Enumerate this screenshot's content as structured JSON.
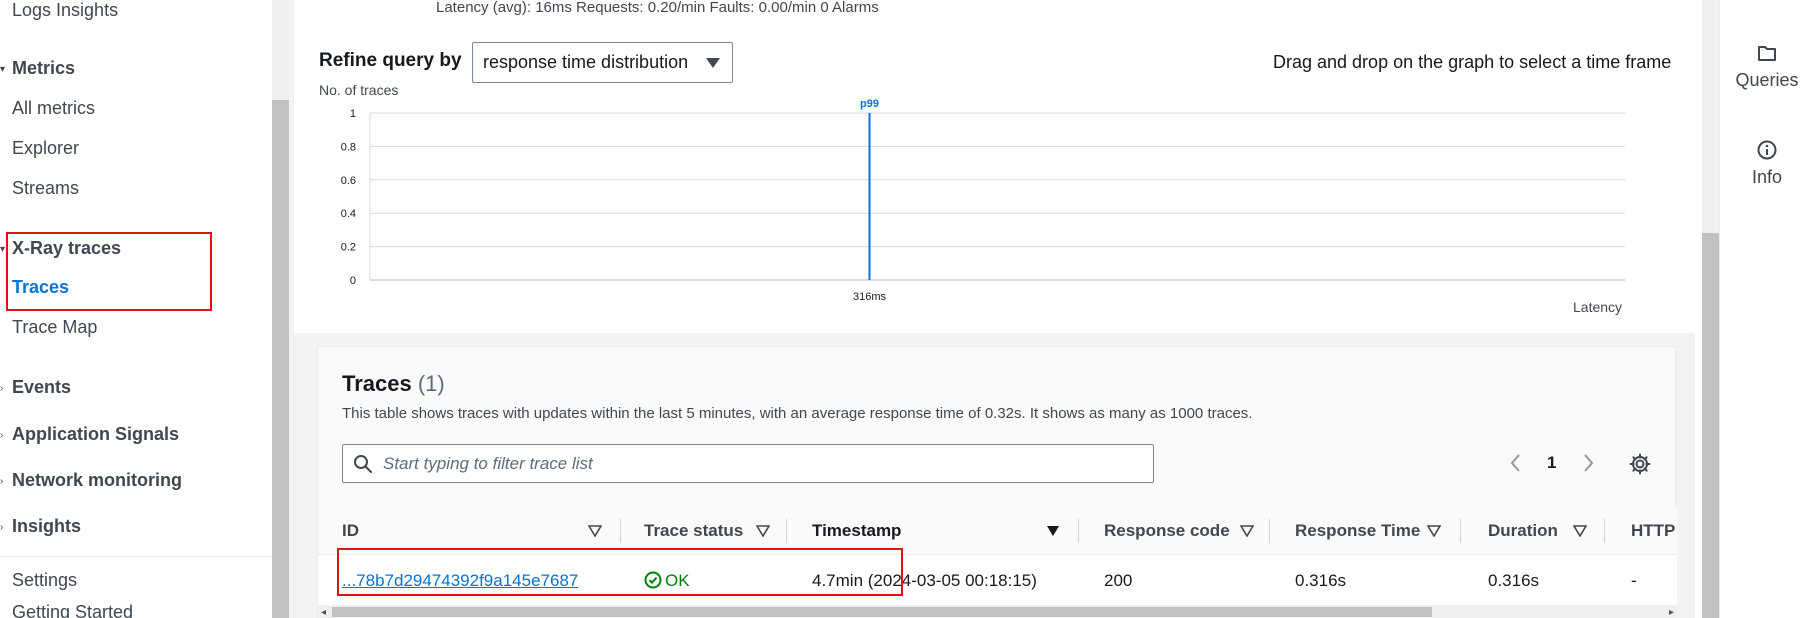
{
  "nav": {
    "logs_insights": "Logs Insights",
    "metrics": "Metrics",
    "all_metrics": "All metrics",
    "explorer": "Explorer",
    "streams": "Streams",
    "xray_traces": "X-Ray traces",
    "traces": "Traces",
    "trace_map": "Trace Map",
    "events": "Events",
    "application_signals": "Application Signals",
    "network_monitoring": "Network monitoring",
    "insights": "Insights",
    "settings": "Settings",
    "getting_started": "Getting Started"
  },
  "right_panel": {
    "queries": "Queries",
    "info": "Info"
  },
  "chart_panel": {
    "metrics_line": "Latency (avg): 16ms   Requests: 0.20/min   Faults: 0.00/min   0 Alarms",
    "refine_label": "Refine query by",
    "refine_value": "response time distribution",
    "drag_hint": "Drag and drop on the graph to select a time frame"
  },
  "chart_data": {
    "type": "bar",
    "ylabel": "No. of traces",
    "xlabel": "Latency",
    "y_ticks": [
      "0",
      "0.2",
      "0.4",
      "0.6",
      "0.8",
      "1"
    ],
    "ylim": [
      0,
      1
    ],
    "categories": [
      "316ms"
    ],
    "values": [
      1
    ],
    "annotation": "p99",
    "accent_color": "#0972d3",
    "grid": true
  },
  "traces": {
    "title": "Traces",
    "count": "(1)",
    "description": "This table shows traces with updates within the last 5 minutes, with an average response time of 0.32s. It shows as many as 1000 traces.",
    "filter_placeholder": "Start typing to filter trace list",
    "page": "1",
    "columns": [
      "ID",
      "Trace status",
      "Timestamp",
      "Response code",
      "Response Time",
      "Duration",
      "HTTP"
    ],
    "row": {
      "id": "...78b7d29474392f9a145e7687",
      "status": "OK",
      "timestamp": "4.7min (2024-03-05 00:18:15)",
      "response_code": "200",
      "response_time": "0.316s",
      "duration": "0.316s",
      "http": "-"
    }
  },
  "colors": {
    "link": "#0972d3",
    "ok": "#037f0c",
    "highlight_box": "#d91515"
  }
}
